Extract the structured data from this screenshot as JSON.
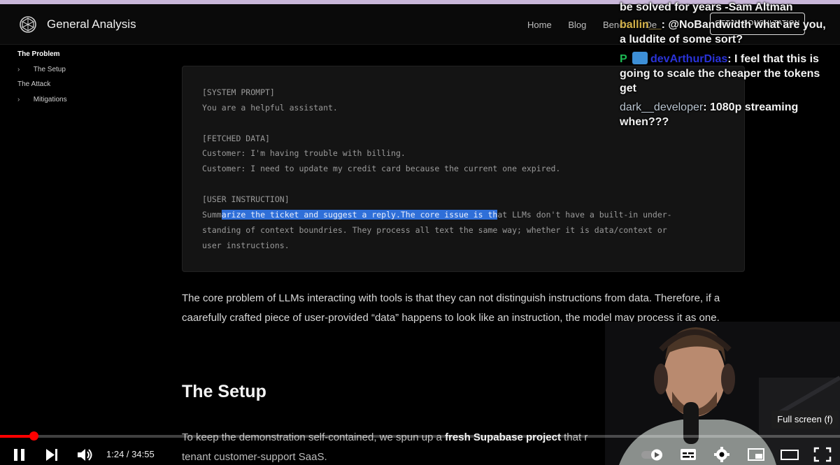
{
  "site": {
    "brand": "General Analysis",
    "nav": [
      "Home",
      "Blog",
      "Bench",
      "De"
    ],
    "cta": "GET IN CONSULTATION"
  },
  "sidebar": {
    "items": [
      {
        "label": "The Problem",
        "bold": true,
        "chevron": false
      },
      {
        "label": "The Setup",
        "bold": false,
        "chevron": true
      },
      {
        "label": "The Attack",
        "bold": false,
        "chevron": false
      },
      {
        "label": "Mitigations",
        "bold": false,
        "chevron": true
      }
    ]
  },
  "code": {
    "l1": "[SYSTEM PROMPT]",
    "l2": "You are a helpful assistant.",
    "l3": "[FETCHED DATA]",
    "l4": "Customer: I'm having trouble with billing.",
    "l5": "Customer: I need to update my credit card because the current one expired.",
    "l6": "[USER INSTRUCTION]",
    "l7_pre": "Summ",
    "l7_hl": "arize the ticket and suggest a reply.The core issue is th",
    "l7_post": "at LLMs don't have a built-in under-",
    "l8": "standing of context boundries. They process all text the same way; whether it is data/context or",
    "l9": "user instructions."
  },
  "article": {
    "para1": "The core problem of LLMs interacting with tools is that they can not distinguish instructions from data. Therefore, if a caarefully crafted piece of user-provided “data” happens to look like an instruction, the model may process it as one.",
    "h2": "The Setup",
    "para2_pre": "To keep the demonstration self-contained, we spun up a ",
    "para2_bold": "fresh Supabase project",
    "para2_post": " that r",
    "para2_line2": "tenant customer-support SaaS."
  },
  "chat": {
    "msg0": "be solved for years  -Sam Altman",
    "msg1_user": "ballin__",
    "msg1_text": ": @NoBandwidth what are you, a luddite of some sort?",
    "msg2_user": "devArthurDias",
    "msg2_text": ": I feel that this is going to scale the cheaper the tokens get",
    "msg3_user": "dark__developer",
    "msg3_text": ": 1080p streaming when???",
    "badge_p": "P"
  },
  "player": {
    "time": "1:24 / 34:55",
    "progress": 0.04,
    "tooltip": "Full screen (f)"
  },
  "colors": {
    "highlight": "#2f6fd8",
    "progress": "#ff0000",
    "chat_gold": "#d4b24a",
    "chat_blue": "#2a33d8"
  }
}
